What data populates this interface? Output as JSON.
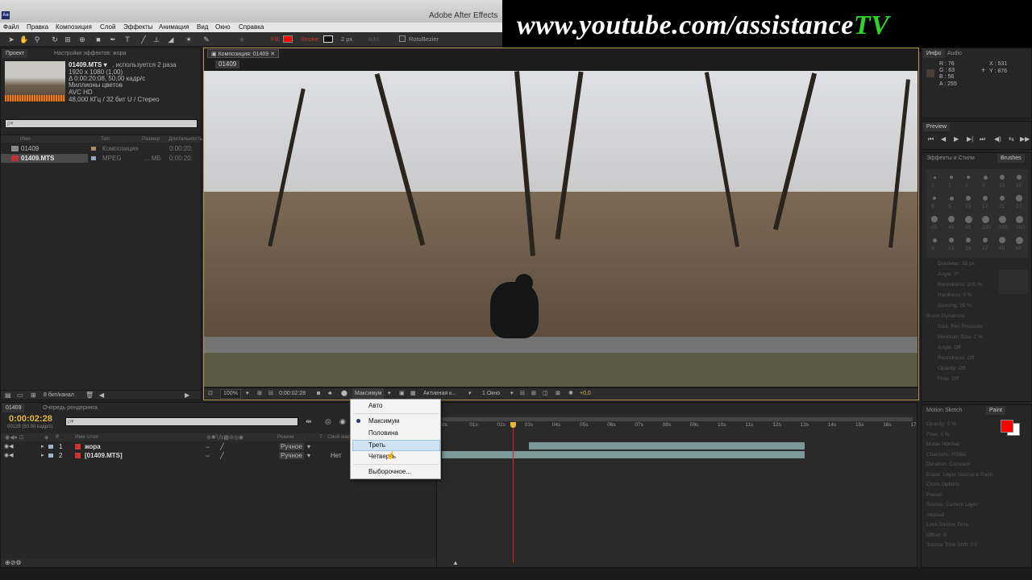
{
  "app": {
    "title": "Adobe After Effects",
    "icon": "Ae"
  },
  "watermark": {
    "prefix": "www.youtube.com/assistance",
    "suffix": "TV",
    "suffix_color": "#2fd12a"
  },
  "menu": [
    "Файл",
    "Правка",
    "Композиция",
    "Слой",
    "Эффекты",
    "Анимация",
    "Вид",
    "Окно",
    "Справка"
  ],
  "toolbar": {
    "fill_label": "Fill:",
    "fill_color": "#ff0000",
    "stroke_label": "Stroke:",
    "stroke_width": "2 px",
    "add_label": "Add:",
    "rotobezier": "RotoBezier"
  },
  "project_panel": {
    "tabs": [
      "Проект",
      "Настройки эффектов: жора"
    ],
    "file_name": "01409.MTS ▾",
    "used": ", используется 2 раза",
    "info": [
      "1920 x 1080 (1,00)",
      "Δ 0:00:20:08, 50,00 кадр/с",
      "Миллионы цветов",
      "AVC HD",
      "48,000 КГц / 32 бит U / Стерео"
    ],
    "search_placeholder": "ρ▾",
    "columns": [
      "Имя",
      "Тип",
      "Размер",
      "Длительность"
    ],
    "items": [
      {
        "name": "01409",
        "type": "Композиция",
        "size": "",
        "duration": "0:00:20:"
      },
      {
        "name": "01409.MTS",
        "type": "MPEG",
        "size": "... МБ",
        "duration": "0:00:20:"
      }
    ],
    "footer": "8 бит/канал"
  },
  "comp_panel": {
    "tab": "Композиция: 01409",
    "breadcrumb": "01409",
    "zoom": "100%",
    "timecode": "0:00:02:28",
    "resolution": "Максимум",
    "camera": "Активная к...",
    "views": "1 Окно",
    "exposure": "+0,0"
  },
  "resolution_menu": {
    "items": [
      "Авто",
      "Максимум",
      "Половина",
      "Треть",
      "Четверть",
      "Выборочное..."
    ],
    "selected": "Максимум",
    "hovered": "Треть"
  },
  "timeline": {
    "tabs": [
      "01409",
      "Очередь рендеринга"
    ],
    "timecode": "0:00:02:28",
    "frame_info": "00128 (50.00 кадр/с)",
    "search_placeholder": "ρ▾",
    "columns": [
      "Имя слоя",
      "Режим",
      "T",
      "Свой маска"
    ],
    "layers": [
      {
        "num": "1",
        "name": "жора",
        "mode": "Ручное",
        "trkmat": ""
      },
      {
        "num": "2",
        "name": "[01409.MTS]",
        "mode": "Ручное",
        "trkmat": "Нет"
      }
    ],
    "ruler": [
      "0s",
      "01s",
      "02s",
      "03s",
      "04s",
      "05s",
      "06s",
      "07s",
      "08s",
      "09s",
      "10s",
      "11s",
      "12s",
      "13s",
      "14s",
      "15s",
      "16s",
      "17"
    ],
    "playhead_seconds": 2.56
  },
  "info_panel": {
    "tabs": [
      "Инфо",
      "Audio"
    ],
    "r": "R : 76",
    "g": "G : 63",
    "b": "B : 56",
    "a": "A : 255",
    "x": "X : 531",
    "y": "Y : 876"
  },
  "preview_panel": {
    "tab": "Preview"
  },
  "effects_panel": {
    "tabs": [
      "Эффекты и Стили",
      "Brushes"
    ]
  },
  "brushes": {
    "sizes": [
      "1",
      "3",
      "5",
      "9",
      "13",
      "19",
      "5",
      "9",
      "13",
      "17",
      "21",
      "27",
      "35",
      "45",
      "65",
      "100",
      "200",
      "300",
      "9",
      "13",
      "19",
      "17",
      "45",
      "65"
    ],
    "props": [
      "Diameter: 35 px",
      "Angle: 0°",
      "Roundness: 100 %",
      "Hardness: 0 %",
      "Spacing: 25 %",
      "Brush Dynamics",
      "Size: Pen Pressure",
      "Minimum Size: 1 %",
      "Angle: Off",
      "Roundness: Off",
      "Opacity: Off",
      "Flow: Off"
    ]
  },
  "paint_panel": {
    "tabs": [
      "Motion Sketch",
      "Paint"
    ],
    "color": "#ff0000",
    "props": [
      "Opacity: 0 %",
      "Flow: 0 %",
      "Mode: Normal",
      "Channels: RGBA",
      "Duration: Constant",
      "Erase: Layer Source & Paint",
      "Clone Options",
      "Preset:",
      "Source: Current Layer",
      "Aligned",
      "Lock Source Time",
      "Offset: 0",
      "Source Time Shift: 0 f"
    ]
  }
}
